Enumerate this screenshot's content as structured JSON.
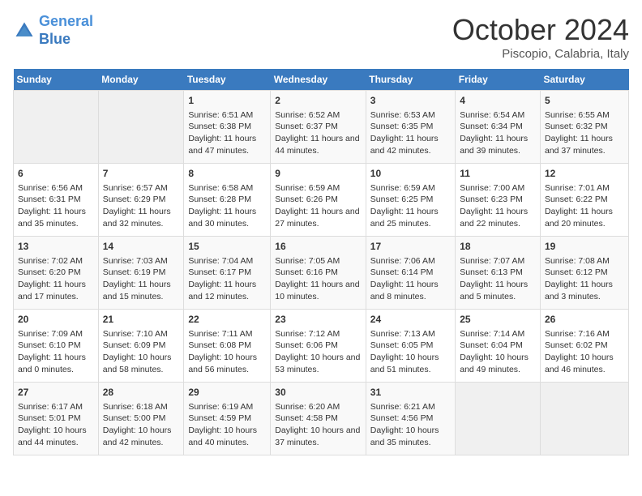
{
  "header": {
    "logo_line1": "General",
    "logo_line2": "Blue",
    "month": "October 2024",
    "location": "Piscopio, Calabria, Italy"
  },
  "weekdays": [
    "Sunday",
    "Monday",
    "Tuesday",
    "Wednesday",
    "Thursday",
    "Friday",
    "Saturday"
  ],
  "weeks": [
    [
      {
        "day": "",
        "content": ""
      },
      {
        "day": "",
        "content": ""
      },
      {
        "day": "1",
        "content": "Sunrise: 6:51 AM\nSunset: 6:38 PM\nDaylight: 11 hours and 47 minutes."
      },
      {
        "day": "2",
        "content": "Sunrise: 6:52 AM\nSunset: 6:37 PM\nDaylight: 11 hours and 44 minutes."
      },
      {
        "day": "3",
        "content": "Sunrise: 6:53 AM\nSunset: 6:35 PM\nDaylight: 11 hours and 42 minutes."
      },
      {
        "day": "4",
        "content": "Sunrise: 6:54 AM\nSunset: 6:34 PM\nDaylight: 11 hours and 39 minutes."
      },
      {
        "day": "5",
        "content": "Sunrise: 6:55 AM\nSunset: 6:32 PM\nDaylight: 11 hours and 37 minutes."
      }
    ],
    [
      {
        "day": "6",
        "content": "Sunrise: 6:56 AM\nSunset: 6:31 PM\nDaylight: 11 hours and 35 minutes."
      },
      {
        "day": "7",
        "content": "Sunrise: 6:57 AM\nSunset: 6:29 PM\nDaylight: 11 hours and 32 minutes."
      },
      {
        "day": "8",
        "content": "Sunrise: 6:58 AM\nSunset: 6:28 PM\nDaylight: 11 hours and 30 minutes."
      },
      {
        "day": "9",
        "content": "Sunrise: 6:59 AM\nSunset: 6:26 PM\nDaylight: 11 hours and 27 minutes."
      },
      {
        "day": "10",
        "content": "Sunrise: 6:59 AM\nSunset: 6:25 PM\nDaylight: 11 hours and 25 minutes."
      },
      {
        "day": "11",
        "content": "Sunrise: 7:00 AM\nSunset: 6:23 PM\nDaylight: 11 hours and 22 minutes."
      },
      {
        "day": "12",
        "content": "Sunrise: 7:01 AM\nSunset: 6:22 PM\nDaylight: 11 hours and 20 minutes."
      }
    ],
    [
      {
        "day": "13",
        "content": "Sunrise: 7:02 AM\nSunset: 6:20 PM\nDaylight: 11 hours and 17 minutes."
      },
      {
        "day": "14",
        "content": "Sunrise: 7:03 AM\nSunset: 6:19 PM\nDaylight: 11 hours and 15 minutes."
      },
      {
        "day": "15",
        "content": "Sunrise: 7:04 AM\nSunset: 6:17 PM\nDaylight: 11 hours and 12 minutes."
      },
      {
        "day": "16",
        "content": "Sunrise: 7:05 AM\nSunset: 6:16 PM\nDaylight: 11 hours and 10 minutes."
      },
      {
        "day": "17",
        "content": "Sunrise: 7:06 AM\nSunset: 6:14 PM\nDaylight: 11 hours and 8 minutes."
      },
      {
        "day": "18",
        "content": "Sunrise: 7:07 AM\nSunset: 6:13 PM\nDaylight: 11 hours and 5 minutes."
      },
      {
        "day": "19",
        "content": "Sunrise: 7:08 AM\nSunset: 6:12 PM\nDaylight: 11 hours and 3 minutes."
      }
    ],
    [
      {
        "day": "20",
        "content": "Sunrise: 7:09 AM\nSunset: 6:10 PM\nDaylight: 11 hours and 0 minutes."
      },
      {
        "day": "21",
        "content": "Sunrise: 7:10 AM\nSunset: 6:09 PM\nDaylight: 10 hours and 58 minutes."
      },
      {
        "day": "22",
        "content": "Sunrise: 7:11 AM\nSunset: 6:08 PM\nDaylight: 10 hours and 56 minutes."
      },
      {
        "day": "23",
        "content": "Sunrise: 7:12 AM\nSunset: 6:06 PM\nDaylight: 10 hours and 53 minutes."
      },
      {
        "day": "24",
        "content": "Sunrise: 7:13 AM\nSunset: 6:05 PM\nDaylight: 10 hours and 51 minutes."
      },
      {
        "day": "25",
        "content": "Sunrise: 7:14 AM\nSunset: 6:04 PM\nDaylight: 10 hours and 49 minutes."
      },
      {
        "day": "26",
        "content": "Sunrise: 7:16 AM\nSunset: 6:02 PM\nDaylight: 10 hours and 46 minutes."
      }
    ],
    [
      {
        "day": "27",
        "content": "Sunrise: 6:17 AM\nSunset: 5:01 PM\nDaylight: 10 hours and 44 minutes."
      },
      {
        "day": "28",
        "content": "Sunrise: 6:18 AM\nSunset: 5:00 PM\nDaylight: 10 hours and 42 minutes."
      },
      {
        "day": "29",
        "content": "Sunrise: 6:19 AM\nSunset: 4:59 PM\nDaylight: 10 hours and 40 minutes."
      },
      {
        "day": "30",
        "content": "Sunrise: 6:20 AM\nSunset: 4:58 PM\nDaylight: 10 hours and 37 minutes."
      },
      {
        "day": "31",
        "content": "Sunrise: 6:21 AM\nSunset: 4:56 PM\nDaylight: 10 hours and 35 minutes."
      },
      {
        "day": "",
        "content": ""
      },
      {
        "day": "",
        "content": ""
      }
    ]
  ]
}
